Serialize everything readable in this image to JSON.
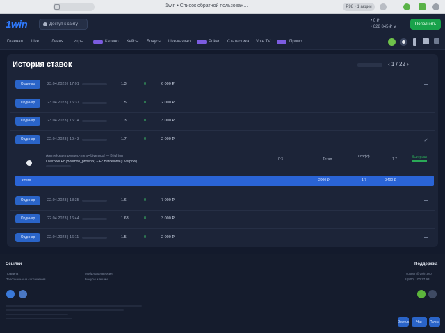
{
  "browser": {
    "tab_url": "1win • Список обратной пользован…",
    "pill_label": "Ρ98 • 1 акции"
  },
  "header": {
    "logo_text": "1win",
    "login_label": "Доступ к сайту",
    "balance_line1": "• 0 ₽",
    "balance_line2": "• 628 845 ₽ ∨",
    "deposit_label": "Пополнить"
  },
  "nav": {
    "items": [
      "Главная",
      "Live",
      "Линия",
      "Игры",
      "Казино",
      "Кейсы",
      "Бонусы",
      "Live-казино",
      "Poker",
      "Статистика",
      "Vote TV",
      "Промо"
    ]
  },
  "history": {
    "title": "История ставок",
    "pager": "‹ 1 / 22 ›",
    "rows": [
      {
        "button": "Ординар",
        "date": "23.04.2023 | 17:01",
        "coef": "1.3",
        "count": "0",
        "amount": "6 000 ₽"
      },
      {
        "button": "Ординар",
        "date": "23.04.2023 | 16:37",
        "coef": "1.5",
        "count": "0",
        "amount": "2 000 ₽"
      },
      {
        "button": "Ординар",
        "date": "23.04.2023 | 16:14",
        "coef": "1.3",
        "count": "0",
        "amount": "3 000 ₽"
      },
      {
        "button": "Ординар",
        "date": "22.04.2023 | 19:43",
        "coef": "1.7",
        "count": "0",
        "amount": "2 000 ₽"
      },
      {
        "button": "Ординар",
        "date": "22.04.2023 | 18:35",
        "coef": "1.6",
        "count": "0",
        "amount": "7 000 ₽"
      },
      {
        "button": "Ординар",
        "date": "22.04.2023 | 16:44",
        "coef": "1.63",
        "count": "0",
        "amount": "3 000 ₽"
      },
      {
        "button": "Ординар",
        "date": "22.04.2023 | 16:11",
        "coef": "1.5",
        "count": "0",
        "amount": "2 000 ₽"
      }
    ],
    "detail": {
      "line1": "Английская премьер-лига • Liverpool — Brighton",
      "line2": "Liverpool Fc (Bourbon_phoenix) – Fc Barcelona (Liverpool)",
      "score": "0:3",
      "type": "Тотал",
      "odds_label": "Коэфф.",
      "coef": "1.7",
      "status": "Выигрыш"
    },
    "total": {
      "label": "итого",
      "amount": "2000 ₽",
      "coef": "1.7",
      "win": "3400 ₽"
    }
  },
  "footer": {
    "left_title": "Ссылки",
    "left_links": [
      "Правила",
      "Персональные соглашения"
    ],
    "mid_links": [
      "Мобильная версия",
      "Бонусы и акции"
    ],
    "right_title": "Поддержка",
    "right_line1": "support@1win.pro",
    "right_line2": "8 (800) 100 77 93",
    "bottom_buttons": [
      "Звонок",
      "Чат",
      "Почта"
    ]
  },
  "colors": {
    "background": "#131a2c",
    "panel": "#1c2438",
    "accent": "#2a64c8",
    "win": "#2aa957"
  }
}
